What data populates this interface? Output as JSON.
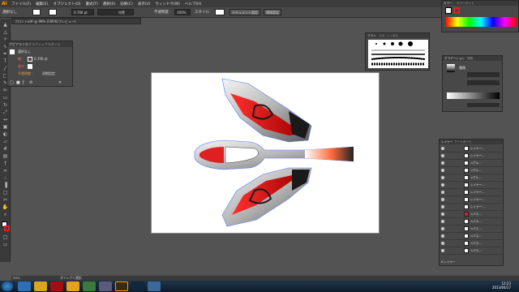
{
  "app": {
    "logo": "Ai"
  },
  "menubar": {
    "items": [
      "ファイル(F)",
      "編集(E)",
      "オブジェクト(O)",
      "書式(T)",
      "選択(S)",
      "効果(C)",
      "表示(V)",
      "ウィンドウ(W)",
      "ヘルプ(H)"
    ],
    "win_controls": [
      "_",
      "□",
      "×"
    ]
  },
  "control": {
    "selection_label": "選択なし",
    "stroke_value": "0.706 pt",
    "brush_label": "均等",
    "opacity_label": "不透明度",
    "opacity_value": "100%",
    "style_label": "スタイル",
    "doc_setup_button": "ドキュメント設定",
    "prefs_button": "環境設定"
  },
  "document_tab": {
    "title": "フロントal# @ 99% (CMYK/プレビュー)"
  },
  "appearance_panel": {
    "tabs": [
      "アピアランス",
      "グラフィックスタイル"
    ],
    "header": "選択なし",
    "rows": [
      {
        "label": "線 :",
        "value": "0.706 pt"
      },
      {
        "label": "塗り :",
        "value": ""
      },
      {
        "label": "不透明度 :",
        "value": "初期設定"
      }
    ]
  },
  "brushes_panel": {
    "tabs": [
      "ブラシ",
      "スタ",
      "シンボル"
    ]
  },
  "color_panel": {
    "tabs": [
      "カラー",
      "カラーガイド"
    ]
  },
  "gradient_panel": {
    "tabs": [
      "グラデーション",
      "透明"
    ],
    "type_label": "種類"
  },
  "layers_panel": {
    "tabs": [
      "レイヤー",
      "アートボード"
    ],
    "rows": [
      "レイヤー...",
      "レイヤー...",
      "<グル...",
      "<グル...",
      "<グル...",
      "レイヤー...",
      "レイヤー...",
      "レイヤー...",
      "レイヤー...",
      "<パス...",
      "<パス...",
      "<パス...",
      "<パス...",
      "<パス...",
      "<パス..."
    ],
    "footer": "6 レイヤー"
  },
  "statusbar": {
    "zoom": "99%",
    "mode": "ダイレクト選択"
  },
  "taskbar": {
    "clock_time": "12:23",
    "clock_date": "2013/04/17"
  },
  "colors": {
    "red": "#e02020",
    "dark": "#1a1a1a",
    "silver": "#c8c8c8"
  }
}
